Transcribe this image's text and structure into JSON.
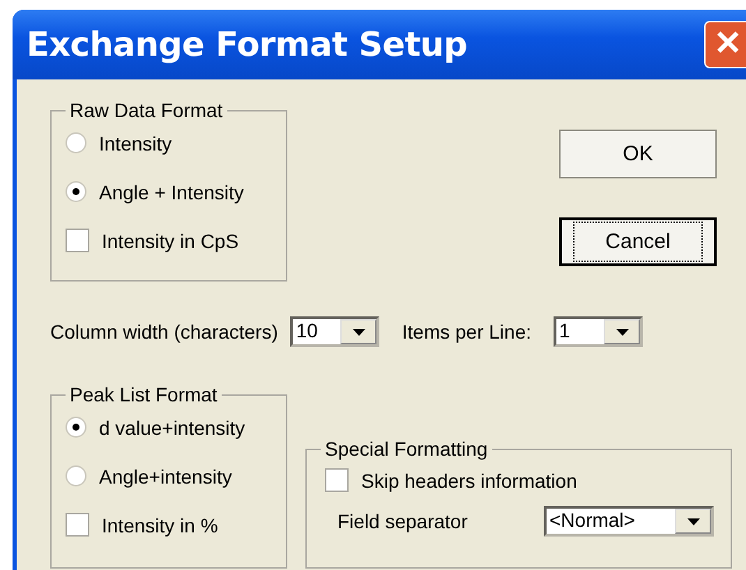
{
  "window": {
    "title": "Exchange Format Setup",
    "close": "✕"
  },
  "raw_data_format": {
    "title": "Raw Data Format",
    "options": [
      {
        "kind": "radio",
        "label": "Intensity",
        "selected": false
      },
      {
        "kind": "radio",
        "label": "Angle + Intensity",
        "selected": true
      },
      {
        "kind": "checkbox",
        "label": "Intensity in CpS",
        "checked": false
      }
    ]
  },
  "buttons": [
    {
      "label": "OK",
      "focused": false
    },
    {
      "label": "Cancel",
      "focused": true
    }
  ],
  "column_width": {
    "label": "Column width (characters)",
    "value": "10"
  },
  "items_per_line": {
    "label": "Items per Line:",
    "value": "1"
  },
  "peak_list_format": {
    "title": "Peak List Format",
    "options": [
      {
        "kind": "radio",
        "label": "d value+intensity",
        "selected": true
      },
      {
        "kind": "radio",
        "label": "Angle+intensity",
        "selected": false
      },
      {
        "kind": "checkbox",
        "label": "Intensity in %",
        "checked": false
      }
    ]
  },
  "special_formatting": {
    "title": "Special Formatting",
    "skip_headers": {
      "label": "Skip headers information",
      "checked": false
    },
    "field_separator": {
      "label": "Field separator",
      "value": "<Normal>"
    }
  }
}
